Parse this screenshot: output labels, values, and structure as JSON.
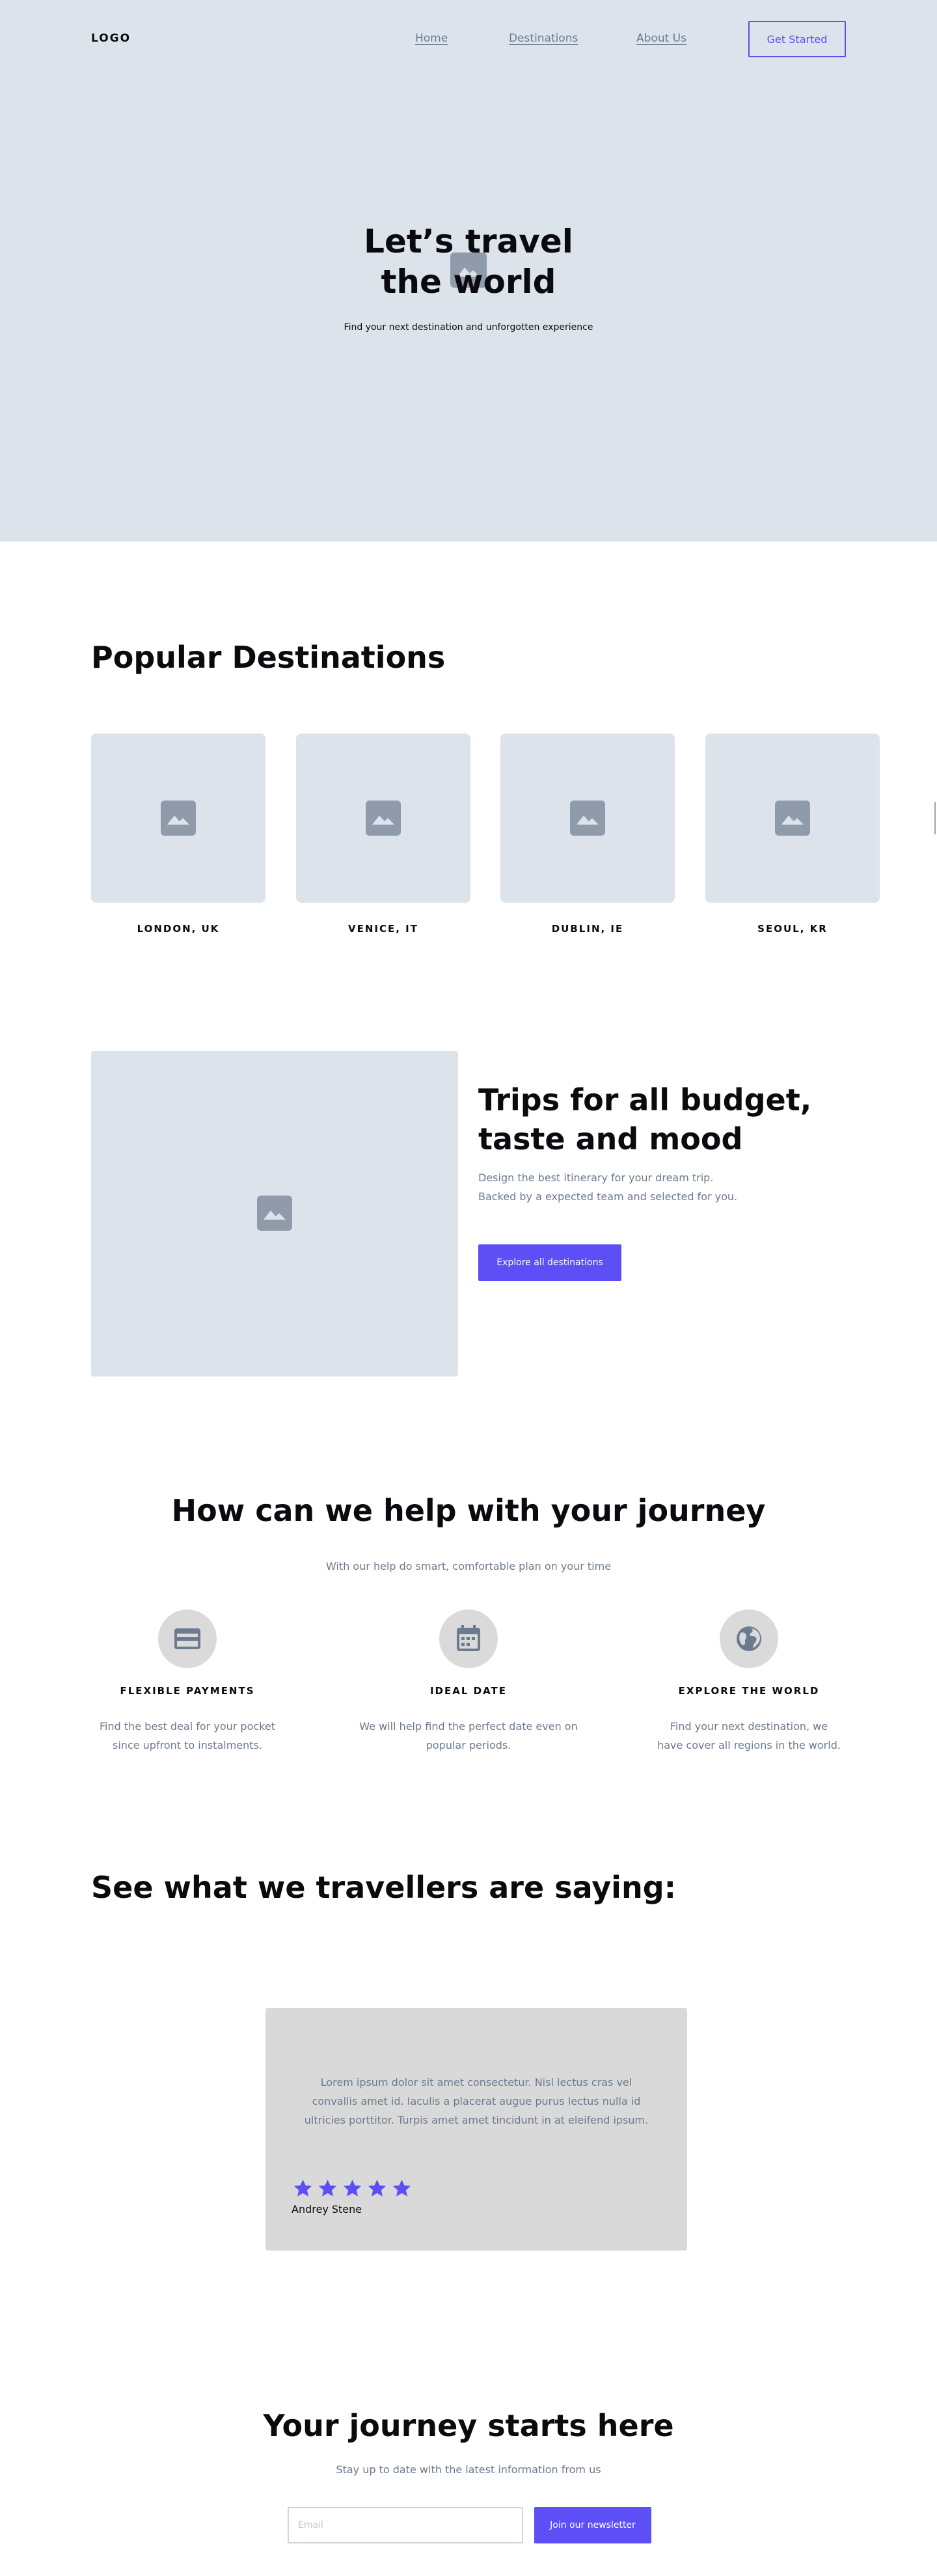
{
  "colors": {
    "accent": "#5b4ff5",
    "hero_bg": "#dce3ea",
    "muted_text": "#6b7a8f",
    "card_gray": "#d9d9d9",
    "icon_gray": "#8f9bab"
  },
  "header": {
    "logo": "LOGO",
    "nav": [
      "Home",
      "Destinations",
      "About Us"
    ],
    "cta": "Get Started"
  },
  "hero": {
    "title_lines": [
      "Let’s travel",
      "the world"
    ],
    "subtitle": "Find your next destination and unforgotten experience",
    "icon": "image-placeholder-icon"
  },
  "popular": {
    "title": "Popular Destinations",
    "cards": [
      {
        "label": "LONDON, UK",
        "icon": "image-placeholder-icon"
      },
      {
        "label": "VENICE, IT",
        "icon": "image-placeholder-icon"
      },
      {
        "label": "DUBLIN, IE",
        "icon": "image-placeholder-icon"
      },
      {
        "label": "SEOUL, KR",
        "icon": "image-placeholder-icon"
      }
    ]
  },
  "trips": {
    "title_lines": [
      "Trips for all budget,",
      "taste and mood"
    ],
    "text_lines": [
      "Design the best itinerary for your dream trip.",
      "Backed by a expected team  and selected for you."
    ],
    "button": "Explore all destinations"
  },
  "help": {
    "title": "How can we help with your journey",
    "subtitle": "With our help do smart, comfortable plan on your time",
    "features": [
      {
        "icon": "credit-card-icon",
        "title": "FLEXIBLE PAYMENTS",
        "text_lines": [
          "Find the best deal for your pocket",
          "since upfront to instalments."
        ]
      },
      {
        "icon": "calendar-icon",
        "title": "IDEAL DATE",
        "text_lines": [
          "We will help find the perfect date even on",
          "popular periods."
        ]
      },
      {
        "icon": "globe-icon",
        "title": "EXPLORE THE WORLD",
        "text_lines": [
          "Find your next destination, we",
          "have cover all regions in the world."
        ]
      }
    ]
  },
  "testimonials": {
    "title": "See what we travellers are saying:",
    "quote_lines": [
      "Lorem ipsum dolor sit amet consectetur. Nisl lectus cras vel",
      "convallis amet id. Iaculis a placerat augue purus lectus nulla id",
      "ultricies porttitor. Turpis amet amet tincidunt in at eleifend ipsum."
    ],
    "rating": 5,
    "author": "Andrey Stene"
  },
  "newsletter": {
    "title": "Your journey starts here",
    "subtitle": "Stay up to date with  the latest information from us",
    "email_placeholder": "Email",
    "email_value": "",
    "button": "Join our newsletter"
  }
}
